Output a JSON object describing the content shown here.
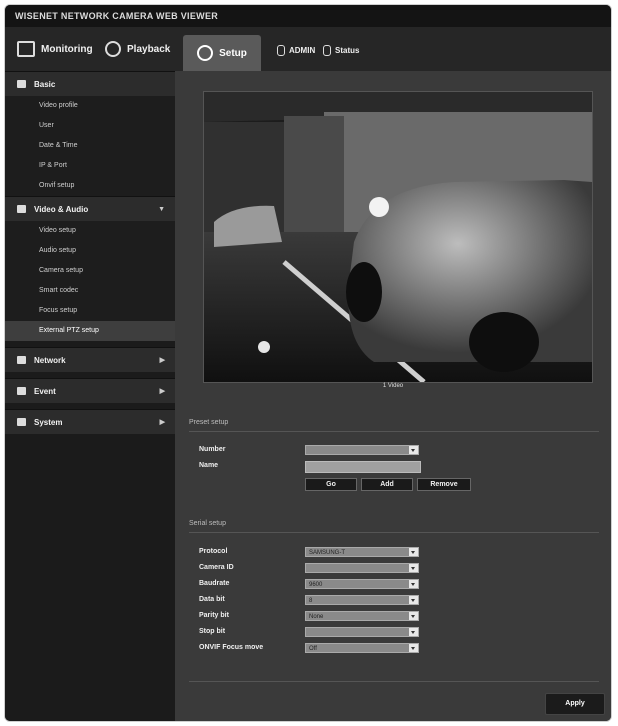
{
  "app": {
    "title": "WISENET NETWORK CAMERA WEB VIEWER"
  },
  "topnav": {
    "monitoring": "Monitoring",
    "playback": "Playback",
    "setup": "Setup",
    "user": "ADMIN",
    "status": "Status"
  },
  "sidebar": {
    "basic": {
      "label": "Basic",
      "items": [
        "Video profile",
        "User",
        "Date & Time",
        "IP & Port",
        "Onvif setup"
      ]
    },
    "video_audio": {
      "label": "Video & Audio",
      "items": [
        "Video setup",
        "Audio setup",
        "Camera setup",
        "Smart codec",
        "Focus setup",
        "External PTZ setup"
      ]
    },
    "network": {
      "label": "Network"
    },
    "event": {
      "label": "Event"
    },
    "system": {
      "label": "System"
    }
  },
  "preview": {
    "caption": "1 Video"
  },
  "preset_setup": {
    "title": "Preset setup",
    "number_label": "Number",
    "name_label": "Name",
    "go_label": "Go",
    "add_label": "Add",
    "remove_label": "Remove"
  },
  "serial_setup": {
    "title": "Serial setup",
    "fields": [
      {
        "label": "Protocol",
        "value": "SAMSUNG-T"
      },
      {
        "label": "Camera ID",
        "value": ""
      },
      {
        "label": "Baudrate",
        "value": "9600"
      },
      {
        "label": "Data bit",
        "value": "8"
      },
      {
        "label": "Parity bit",
        "value": "None"
      },
      {
        "label": "Stop bit",
        "value": ""
      },
      {
        "label": "ONVIF Focus move",
        "value": "Off"
      }
    ]
  },
  "footer": {
    "apply_label": "Apply"
  }
}
